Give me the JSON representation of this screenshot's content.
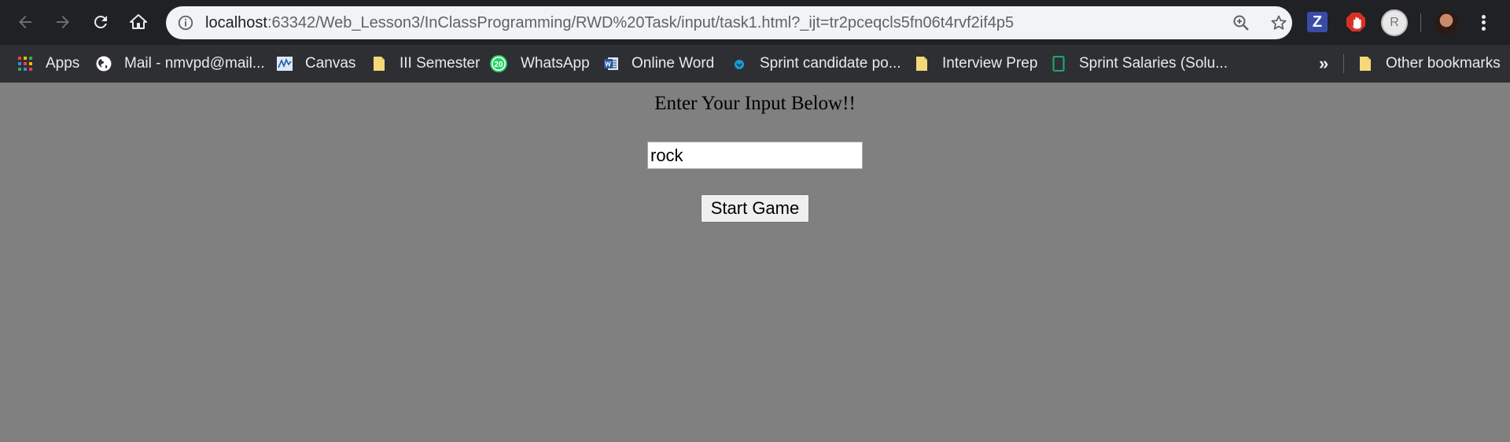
{
  "browser": {
    "url_host": "localhost",
    "url_rest": ":63342/Web_Lesson3/InClassProgramming/RWD%20Task/input/task1.html?_ijt=tr2pceqcls5fn06t4rvf2if4p5",
    "extension_z_label": "Z",
    "profile_initial": "R",
    "icons": {
      "back": "arrow-left-icon",
      "forward": "arrow-right-icon",
      "reload": "reload-icon",
      "home": "home-icon",
      "site_info": "info-icon",
      "zoom": "zoom-in-icon",
      "bookmark_star": "star-icon",
      "menu": "more-vertical-icon"
    }
  },
  "bookmarks": {
    "items": [
      {
        "label": "Apps",
        "icon": "apps-grid-icon"
      },
      {
        "label": "Mail - nmvpd@mail...",
        "icon": "globe-icon"
      },
      {
        "label": "Canvas",
        "icon": "canvas-logo-icon"
      },
      {
        "label": "III Semester",
        "icon": "folder-icon"
      },
      {
        "label": "WhatsApp",
        "icon": "whatsapp-icon"
      },
      {
        "label": "Online Word",
        "icon": "word-icon"
      },
      {
        "label": "Sprint candidate po...",
        "icon": "sprint-icon"
      },
      {
        "label": "Interview Prep",
        "icon": "folder-icon"
      },
      {
        "label": "Sprint Salaries (Solu...",
        "icon": "sheet-icon"
      }
    ],
    "overflow_label": "»",
    "other_label": "Other bookmarks"
  },
  "page": {
    "heading": "Enter Your Input Below!!",
    "input_value": "rock",
    "button_label": "Start Game"
  },
  "colors": {
    "page_background": "#808080",
    "toolbar_background": "#202124",
    "bookmarks_background": "#2e2f32"
  }
}
